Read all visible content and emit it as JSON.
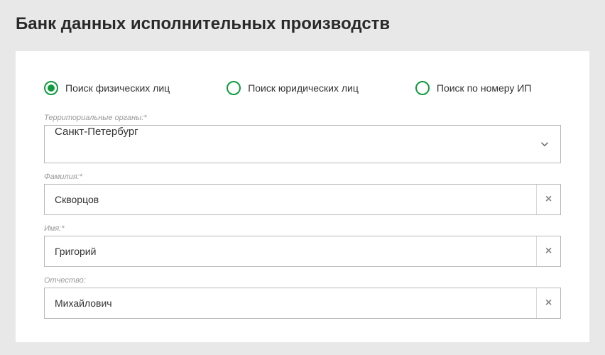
{
  "title": "Банк данных исполнительных производств",
  "radios": {
    "individual": "Поиск физических лиц",
    "legal": "Поиск юридических лиц",
    "byNumber": "Поиск по номеру ИП"
  },
  "labels": {
    "territory": "Территориальные органы:*",
    "lastname": "Фамилия:*",
    "firstname": "Имя:*",
    "patronymic": "Отчество:"
  },
  "values": {
    "territory": "Санкт-Петербург",
    "lastname": "Скворцов",
    "firstname": "Григорий",
    "patronymic": "Михайлович"
  }
}
